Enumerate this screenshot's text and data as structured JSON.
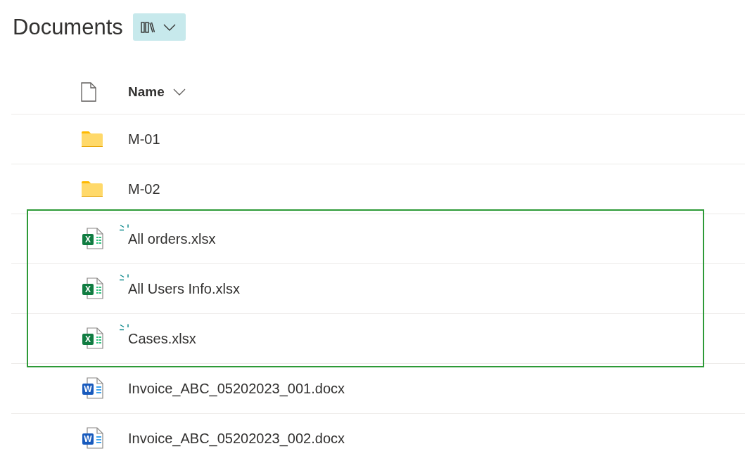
{
  "title": "Documents",
  "view_button": {
    "open": false
  },
  "columns": [
    {
      "kind": "type"
    },
    {
      "kind": "name",
      "label": "Name"
    }
  ],
  "rows": [
    {
      "kind": "folder",
      "name": "M-01",
      "is_new": false,
      "highlighted": false
    },
    {
      "kind": "folder",
      "name": "M-02",
      "is_new": false,
      "highlighted": false
    },
    {
      "kind": "excel",
      "icon_letter": "X",
      "name": "All orders.xlsx",
      "is_new": true,
      "highlighted": true
    },
    {
      "kind": "excel",
      "icon_letter": "X",
      "name": "All Users Info.xlsx",
      "is_new": true,
      "highlighted": true
    },
    {
      "kind": "excel",
      "icon_letter": "X",
      "name": "Cases.xlsx",
      "is_new": true,
      "highlighted": true
    },
    {
      "kind": "word",
      "icon_letter": "W",
      "name": "Invoice_ABC_05202023_001.docx",
      "is_new": false,
      "highlighted": false
    },
    {
      "kind": "word",
      "icon_letter": "W",
      "name": "Invoice_ABC_05202023_002.docx",
      "is_new": false,
      "highlighted": false
    }
  ]
}
